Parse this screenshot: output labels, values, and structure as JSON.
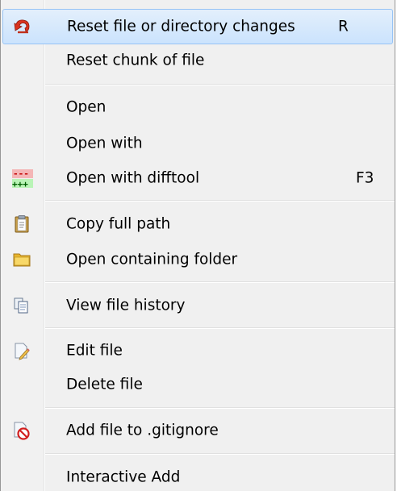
{
  "menu": {
    "items": [
      {
        "label": "Reset file or directory changes",
        "shortcut": "R",
        "icon": "undo-icon"
      },
      {
        "label": "Reset chunk of file",
        "shortcut": "",
        "icon": ""
      },
      {
        "label": "Open",
        "shortcut": "",
        "icon": ""
      },
      {
        "label": "Open with",
        "shortcut": "",
        "icon": ""
      },
      {
        "label": "Open with difftool",
        "shortcut": "F3",
        "icon": "diff-icon"
      },
      {
        "label": "Copy full path",
        "shortcut": "",
        "icon": "clipboard-icon"
      },
      {
        "label": "Open containing folder",
        "shortcut": "",
        "icon": "folder-icon"
      },
      {
        "label": "View file history",
        "shortcut": "",
        "icon": "copy-pages-icon"
      },
      {
        "label": "Edit file",
        "shortcut": "",
        "icon": "pencil-page-icon"
      },
      {
        "label": "Delete file",
        "shortcut": "",
        "icon": ""
      },
      {
        "label": "Add file to .gitignore",
        "shortcut": "",
        "icon": "no-entry-icon"
      },
      {
        "label": "Interactive Add",
        "shortcut": "",
        "icon": ""
      }
    ],
    "diff_icon_text": {
      "removed": "---",
      "added": "+++"
    }
  }
}
